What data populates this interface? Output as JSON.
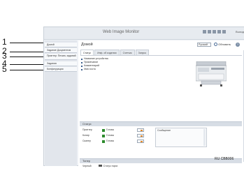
{
  "callouts": [
    "1",
    "2",
    "3",
    "4",
    "5"
  ],
  "header": {
    "app_title": "Web Image Monitor",
    "logout_label": "Выход"
  },
  "sidebar": {
    "items": [
      {
        "label": "Домой"
      },
      {
        "label": "Задание Документов"
      },
      {
        "label": "Принтер: Печать заданий"
      },
      {
        "label": "Задания"
      },
      {
        "label": "Конфигурация"
      }
    ]
  },
  "main": {
    "title": "Домой",
    "language": "Русский",
    "refresh_label": "Обновить",
    "help_icon": "?",
    "tabs": [
      {
        "label": "Статус",
        "active": true
      },
      {
        "label": "Инф. об изделии",
        "active": false
      },
      {
        "label": "Счетчик",
        "active": false
      },
      {
        "label": "Запрос",
        "active": false
      }
    ],
    "bullets": [
      "Название устройства",
      "Примечание",
      "Комментарий",
      "Имя хоста"
    ]
  },
  "status_section": {
    "title": "Статус",
    "rows": [
      {
        "label": "Принтер",
        "value": "Готова"
      },
      {
        "label": "Копир",
        "value": "Готова"
      },
      {
        "label": "Сканер",
        "value": "Готова"
      }
    ],
    "message_label": "Сообщение"
  },
  "toner_section": {
    "title": "Тонер",
    "row_label": "Черный",
    "row_value": "Статус норм."
  },
  "figure_code": "RU CBB006",
  "colors": {
    "status_ok": "#2d8b2d",
    "accent": "#3d5f8c",
    "section_bar": "#d7dde5"
  },
  "icons": [
    "printer-image",
    "refresh-icon",
    "help-icon",
    "status-ok-icon",
    "toner-icon"
  ]
}
